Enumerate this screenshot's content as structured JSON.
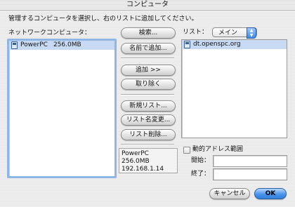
{
  "window": {
    "title": "コンピュータ"
  },
  "instruction": "管理するコンピュータを選択し、右のリストに追加してください。",
  "network": {
    "label": "ネットワークコンピュータ：",
    "items": [
      {
        "name": "PowerPC",
        "size": "256.0MB"
      }
    ]
  },
  "buttons": {
    "search": "検索...",
    "add_by_name": "名前で追加...",
    "add": "追加 >>",
    "remove": "取り除く",
    "new_list": "新規リスト...",
    "rename_list": "リスト名変更...",
    "delete_list": "リスト削除...",
    "cancel": "キャンセル",
    "ok": "OK"
  },
  "list": {
    "label": "リスト：",
    "selected": "メイン",
    "items": [
      {
        "name": "dt.openspc.org"
      }
    ]
  },
  "info": {
    "line1": "PowerPC　256.0MB",
    "line2": "192.168.1.14"
  },
  "dynamic_range": {
    "label": "動的アドレス範囲",
    "start_label": "開始：",
    "end_label": "終了：",
    "start_value": "",
    "end_value": ""
  },
  "colors": {
    "selection": "#c8d9f3",
    "focus_ring": "#8fb7e6",
    "ok_button": "#4c95ea"
  }
}
